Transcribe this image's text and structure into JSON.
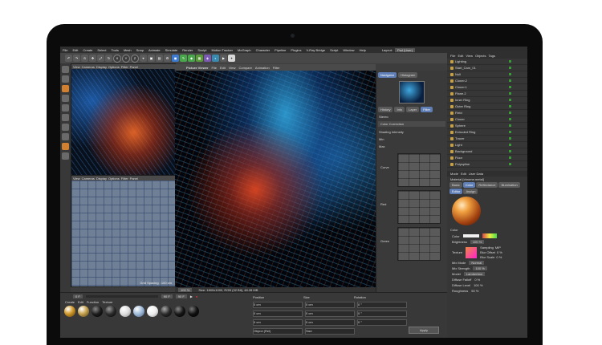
{
  "menubar": {
    "items": [
      "File",
      "Edit",
      "Create",
      "Select",
      "Tools",
      "Mesh",
      "Snap",
      "Animate",
      "Simulate",
      "Render",
      "Sculpt",
      "Motion Tracker",
      "MoGraph",
      "Character",
      "Pipeline",
      "Plugins",
      "V-Ray Bridge",
      "Script",
      "Window",
      "Help"
    ],
    "layout_label": "Layout:",
    "layout_value": "Psd (User)"
  },
  "viewports": {
    "top_left": {
      "tabs": [
        "View",
        "Cameras",
        "Display",
        "Options",
        "Filter",
        "Panel"
      ]
    },
    "bottom_left": {
      "tabs": [
        "View",
        "Cameras",
        "Display",
        "Options",
        "Filter",
        "Panel"
      ],
      "grid_label": "Grid Spacing : 100 cm"
    }
  },
  "picture_viewer": {
    "title": "Picture Viewer",
    "menu": [
      "File",
      "Edit",
      "View",
      "Compare",
      "Animation",
      "Filter"
    ],
    "zoom": "100 %",
    "status": "Size: 1600x1000, RGB (32 Bit), 48.28 MB"
  },
  "histogram": {
    "tabs": [
      "Navigator",
      "Histogram"
    ],
    "subtabs": [
      "History",
      "Info",
      "Layer",
      "Filter"
    ],
    "stereo_label": "Stereo",
    "color_correction": "Color Correction",
    "fields": [
      "Shading Intensity",
      "Min",
      "Max"
    ],
    "curve_labels": [
      "Curve",
      "Red",
      "Green"
    ]
  },
  "object_manager": {
    "menu": [
      "File",
      "Edit",
      "View",
      "Objects",
      "Tags"
    ],
    "objects": [
      "Lighting",
      "Start_Cam_01",
      "Null",
      "Cloner.2",
      "Cloner.1",
      "Plane.2",
      "Inner Ring",
      "Outer Ring",
      "Field",
      "Cloner",
      "Sphere",
      "Extruded Ring",
      "Tracer",
      "Light",
      "Background",
      "Floor",
      "Polyspline"
    ]
  },
  "attributes": {
    "menu": [
      "Mode",
      "Edit",
      "User Data"
    ],
    "title": "Material [chrome.metal]",
    "tabs": [
      "Basic",
      "Color",
      "Reflectance",
      "Illumination",
      "Editor",
      "Assign"
    ],
    "section": "Color",
    "color_label": "Color",
    "brightness_label": "Brightness",
    "brightness_value": "100 %",
    "texture_label": "Texture",
    "sampling_label": "Sampling",
    "sampling_value": "MIP",
    "blur_offset_label": "Blur Offset",
    "blur_offset_value": "0 %",
    "blur_scale_label": "Blur Scale",
    "blur_scale_value": "0 %",
    "mix_mode_label": "Mix Mode",
    "mix_mode_value": "Normal",
    "mix_strength_label": "Mix Strength",
    "mix_strength_value": "100 %",
    "model_label": "Model",
    "model_value": "Lambertian",
    "diffuse_falloff_label": "Diffuse Falloff",
    "diffuse_falloff_value": "0 %",
    "diffuse_level_label": "Diffuse Level",
    "diffuse_level_value": "100 %",
    "roughness_label": "Roughness",
    "roughness_value": "50 %"
  },
  "timeline": {
    "start": "0 F",
    "end": "90 F",
    "current": "90 F"
  },
  "materials": {
    "menu": [
      "Create",
      "Edit",
      "Function",
      "Texture"
    ],
    "colors": [
      "#d29a2b",
      "#c7a452",
      "#1b1b1b",
      "#2b2b2b",
      "#ffffff",
      "#9bb8d6",
      "#ffffff",
      "#2a2a2a",
      "#151515",
      "#0f0f0f"
    ]
  },
  "coordinates": {
    "headers": [
      "Position",
      "Size",
      "Rotation"
    ],
    "x": [
      "0 cm",
      "0 cm",
      "0 °"
    ],
    "y": [
      "0 cm",
      "0 cm",
      "0 °"
    ],
    "z": [
      "0 cm",
      "0 cm",
      "0 °"
    ],
    "mode": "Object (Rel)",
    "size_mode": "Size",
    "apply": "Apply"
  }
}
